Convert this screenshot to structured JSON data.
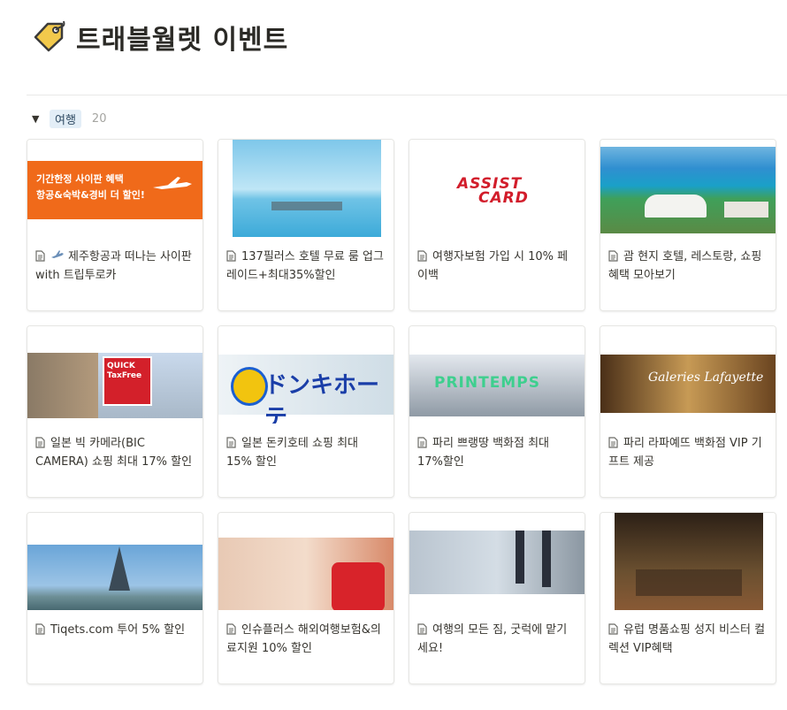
{
  "page": {
    "title": "트래블월렛 이벤트",
    "icon": "tag-icon"
  },
  "group": {
    "label": "여행",
    "count": "20",
    "toggle": "▼"
  },
  "cards": [
    {
      "title": "제주항공과 떠나는 사이판 with 트립투로카",
      "emoji": "airplane-icon",
      "cover": "jeju",
      "cover_lines": [
        "기간한정 사이판 혜택",
        "항공&숙박&경비 더 할인!"
      ]
    },
    {
      "title": "137필러스 호텔 무료 룸 업그레이드+최대35%할인",
      "cover": "hotel"
    },
    {
      "title": "여행자보험 가입 시 10% 페이백",
      "cover": "assist",
      "cover_lines": [
        "ASSIST",
        "CARD"
      ]
    },
    {
      "title": "괌 현지 호텔, 레스토랑, 쇼핑 혜택 모아보기",
      "cover": "guam"
    },
    {
      "title": "일본 빅 카메라(BIC CAMERA) 쇼핑 최대 17% 할인",
      "cover": "bic",
      "cover_lines": [
        "QUICK",
        "TaxFree"
      ]
    },
    {
      "title": "일본 돈키호테 쇼핑 최대 15% 할인",
      "cover": "donki",
      "cover_lines": [
        "ドンキホーテ"
      ]
    },
    {
      "title": "파리 쁘랭땅 백화점 최대 17%할인",
      "cover": "print",
      "cover_lines": [
        "PRINTEMPS"
      ]
    },
    {
      "title": "파리 라파예뜨 백화점 VIP 기프트 제공",
      "cover": "lafay",
      "cover_lines": [
        "Galeries Lafayette"
      ]
    },
    {
      "title": "Tiqets.com 투어 5% 할인",
      "cover": "paris"
    },
    {
      "title": "인슈플러스 해외여행보험&의료지원 10% 할인",
      "cover": "insu"
    },
    {
      "title": "여행의 모든 짐, 굿럭에 맡기세요!",
      "cover": "bag"
    },
    {
      "title": "유럽 명품쇼핑 성지 비스터 컬렉션 VIP혜택",
      "cover": "vip"
    }
  ],
  "colors": {
    "accent_pill": "#e3eef7",
    "text": "#37352f",
    "muted": "#a5a5a1"
  }
}
